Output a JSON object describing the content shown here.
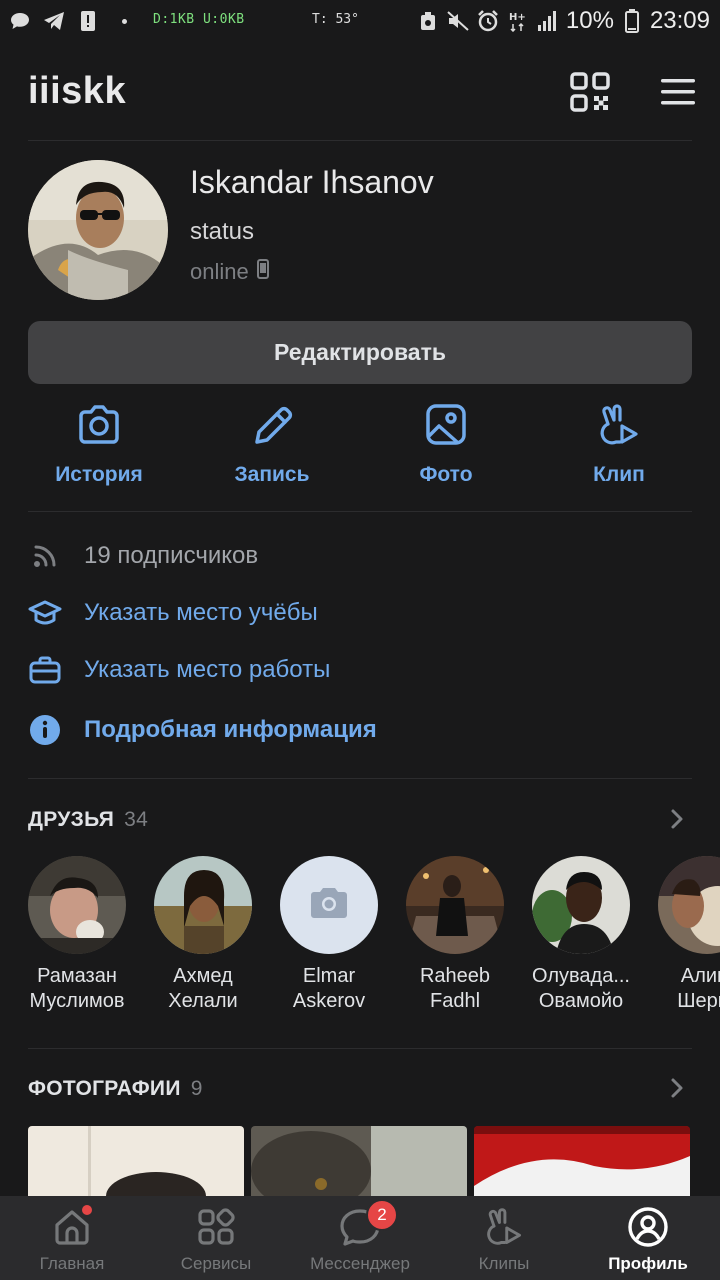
{
  "status_bar": {
    "traffic": "D:1KB  U:0KB",
    "temperature": "T: 53°",
    "battery": "10%",
    "time": "23:09"
  },
  "header": {
    "brand": "iiiskk"
  },
  "profile": {
    "name": "Iskandar Ihsanov",
    "status": "status",
    "presence": "online",
    "edit_label": "Редактировать"
  },
  "actions": [
    {
      "label": "История",
      "icon": "camera-icon"
    },
    {
      "label": "Запись",
      "icon": "pencil-icon"
    },
    {
      "label": "Фото",
      "icon": "image-icon"
    },
    {
      "label": "Клип",
      "icon": "clip-icon"
    }
  ],
  "info": {
    "followers": "19 подписчиков",
    "study": "Указать место учёбы",
    "work": "Указать место работы",
    "details": "Подробная информация"
  },
  "friends": {
    "title": "ДРУЗЬЯ",
    "count": "34",
    "items": [
      {
        "line1": "Рамазан",
        "line2": "Муслимов"
      },
      {
        "line1": "Ахмед",
        "line2": "Хелали"
      },
      {
        "line1": "Elmar",
        "line2": "Askerov"
      },
      {
        "line1": "Raheeb",
        "line2": "Fadhl"
      },
      {
        "line1": "Олувада...",
        "line2": "Овамойо"
      },
      {
        "line1": "Алиш",
        "line2": "Шерку"
      }
    ]
  },
  "photos": {
    "title": "ФОТОГРАФИИ",
    "count": "9"
  },
  "bottom_nav": {
    "tabs": [
      {
        "label": "Главная",
        "icon": "home-icon"
      },
      {
        "label": "Сервисы",
        "icon": "services-icon"
      },
      {
        "label": "Мессенджер",
        "icon": "messenger-icon",
        "badge": "2"
      },
      {
        "label": "Клипы",
        "icon": "clips-icon"
      },
      {
        "label": "Профиль",
        "icon": "profile-icon",
        "active": true
      }
    ]
  },
  "colors": {
    "accent": "#71aaeb",
    "background": "#19191a",
    "badge": "#e64646"
  }
}
